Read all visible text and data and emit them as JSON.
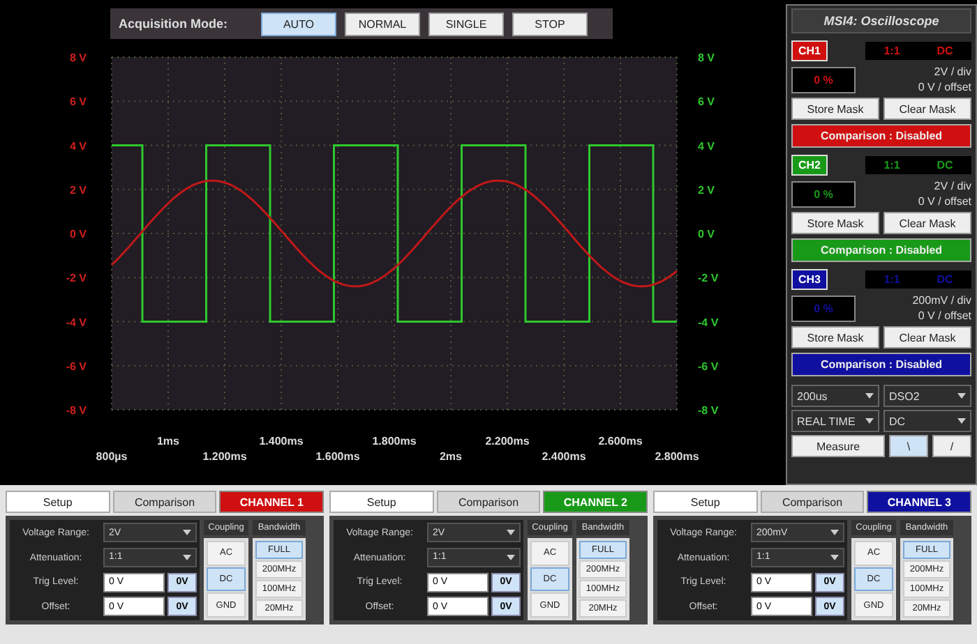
{
  "acquisition": {
    "label": "Acquisition Mode:",
    "modes": [
      {
        "label": "AUTO",
        "selected": true
      },
      {
        "label": "NORMAL",
        "selected": false
      },
      {
        "label": "SINGLE",
        "selected": false
      },
      {
        "label": "STOP",
        "selected": false
      }
    ]
  },
  "plot": {
    "left_axis": [
      "8 V",
      "6 V",
      "4 V",
      "2 V",
      "0 V",
      "-2 V",
      "-4 V",
      "-6 V",
      "-8 V"
    ],
    "right_axis": [
      "8 V",
      "6 V",
      "4 V",
      "2 V",
      "0 V",
      "-2 V",
      "-4 V",
      "-6 V",
      "-8 V"
    ],
    "time_axis": [
      "800µs",
      "1ms",
      "1.200ms",
      "1.400ms",
      "1.600ms",
      "1.800ms",
      "2ms",
      "2.200ms",
      "2.400ms",
      "2.600ms",
      "2.800ms"
    ]
  },
  "panel": {
    "title": "MSI4: Oscilloscope",
    "channels": [
      {
        "badge": "CH1",
        "color": "#d01010",
        "ratio": "1:1",
        "coupling": "DC",
        "percent": "0 %",
        "scale": "2V",
        "scale_unit": "/ div",
        "offset": "0 V",
        "offset_unit": "/ offset",
        "store": "Store Mask",
        "clear": "Clear Mask",
        "comparison": "Comparison : Disabled"
      },
      {
        "badge": "CH2",
        "color": "#189a18",
        "ratio": "1:1",
        "coupling": "DC",
        "percent": "0 %",
        "scale": "2V",
        "scale_unit": "/ div",
        "offset": "0 V",
        "offset_unit": "/ offset",
        "store": "Store Mask",
        "clear": "Clear Mask",
        "comparison": "Comparison : Disabled"
      },
      {
        "badge": "CH3",
        "color": "#1010a0",
        "ratio": "1:1",
        "coupling": "DC",
        "percent": "0 %",
        "scale": "200mV",
        "scale_unit": "/ div",
        "offset": "0 V",
        "offset_unit": "/ offset",
        "store": "Store Mask",
        "clear": "Clear Mask",
        "comparison": "Comparison : Disabled"
      }
    ],
    "timebase": "200us",
    "mode": "DSO2",
    "sampling": "REAL TIME",
    "trigger_coupling": "DC",
    "measure": "Measure",
    "slopes": [
      {
        "label": "\\",
        "selected": true
      },
      {
        "label": "/",
        "selected": false
      }
    ]
  },
  "channel_panels": [
    {
      "tabs": [
        {
          "label": "Setup",
          "selected": true
        },
        {
          "label": "Comparison",
          "selected": false
        }
      ],
      "title": "CHANNEL 1",
      "color": "#d01010",
      "fields": [
        {
          "kind": "select",
          "label": "Voltage Range:",
          "value": "2V"
        },
        {
          "kind": "select",
          "label": "Attenuation:",
          "value": "1:1"
        },
        {
          "kind": "input",
          "label": "Trig Level:",
          "value": "0 V",
          "button": "0V"
        },
        {
          "kind": "input",
          "label": "Offset:",
          "value": "0 V",
          "button": "0V"
        }
      ],
      "coupling": {
        "title": "Coupling",
        "options": [
          {
            "label": "AC",
            "selected": false
          },
          {
            "label": "DC",
            "selected": true
          },
          {
            "label": "GND",
            "selected": false
          }
        ]
      },
      "bandwidth": {
        "title": "Bandwidth",
        "options": [
          {
            "label": "FULL",
            "selected": true
          },
          {
            "label": "200MHz",
            "selected": false
          },
          {
            "label": "100MHz",
            "selected": false
          },
          {
            "label": "20MHz",
            "selected": false
          }
        ]
      }
    },
    {
      "tabs": [
        {
          "label": "Setup",
          "selected": true
        },
        {
          "label": "Comparison",
          "selected": false
        }
      ],
      "title": "CHANNEL 2",
      "color": "#189a18",
      "fields": [
        {
          "kind": "select",
          "label": "Voltage Range:",
          "value": "2V"
        },
        {
          "kind": "select",
          "label": "Attenuation:",
          "value": "1:1"
        },
        {
          "kind": "input",
          "label": "Trig Level:",
          "value": "0 V",
          "button": "0V"
        },
        {
          "kind": "input",
          "label": "Offset:",
          "value": "0 V",
          "button": "0V"
        }
      ],
      "coupling": {
        "title": "Coupling",
        "options": [
          {
            "label": "AC",
            "selected": false
          },
          {
            "label": "DC",
            "selected": true
          },
          {
            "label": "GND",
            "selected": false
          }
        ]
      },
      "bandwidth": {
        "title": "Bandwidth",
        "options": [
          {
            "label": "FULL",
            "selected": true
          },
          {
            "label": "200MHz",
            "selected": false
          },
          {
            "label": "100MHz",
            "selected": false
          },
          {
            "label": "20MHz",
            "selected": false
          }
        ]
      }
    },
    {
      "tabs": [
        {
          "label": "Setup",
          "selected": true
        },
        {
          "label": "Comparison",
          "selected": false
        }
      ],
      "title": "CHANNEL 3",
      "color": "#1010a0",
      "fields": [
        {
          "kind": "select",
          "label": "Voltage Range:",
          "value": "200mV"
        },
        {
          "kind": "select",
          "label": "Attenuation:",
          "value": "1:1"
        },
        {
          "kind": "input",
          "label": "Trig Level:",
          "value": "0 V",
          "button": "0V"
        },
        {
          "kind": "input",
          "label": "Offset:",
          "value": "0 V",
          "button": "0V"
        }
      ],
      "coupling": {
        "title": "Coupling",
        "options": [
          {
            "label": "AC",
            "selected": false
          },
          {
            "label": "DC",
            "selected": true
          },
          {
            "label": "GND",
            "selected": false
          }
        ]
      },
      "bandwidth": {
        "title": "Bandwidth",
        "options": [
          {
            "label": "FULL",
            "selected": true
          },
          {
            "label": "200MHz",
            "selected": false
          },
          {
            "label": "100MHz",
            "selected": false
          },
          {
            "label": "20MHz",
            "selected": false
          }
        ]
      }
    }
  ]
}
